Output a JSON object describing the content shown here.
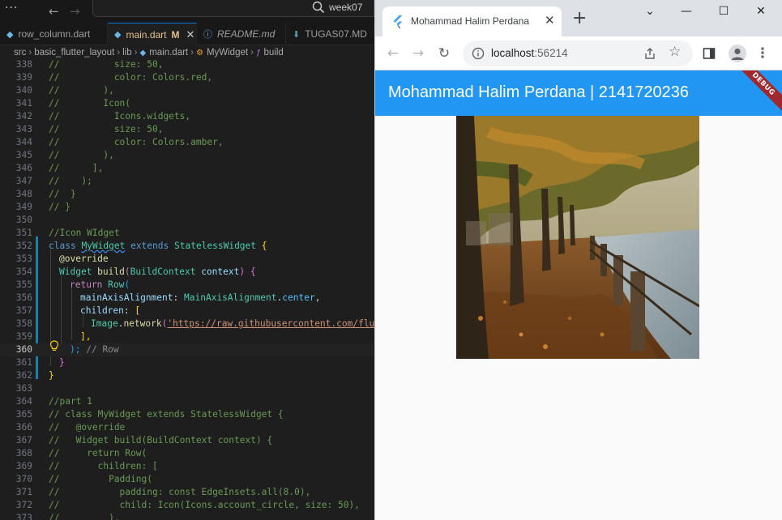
{
  "vscode": {
    "menu_dots": "···",
    "nav_back": "←",
    "nav_forward": "→",
    "search_text": "week07",
    "tabs": [
      {
        "label": "row_column.dart",
        "icon": "dart-file-icon"
      },
      {
        "label": "main.dart",
        "marker": "M",
        "icon": "dart-file-icon",
        "active": true
      },
      {
        "label": "README.md",
        "icon": "info-icon"
      },
      {
        "label": "TUGAS07.MD",
        "icon": "download-icon"
      }
    ],
    "close_glyph": "✕",
    "breadcrumb": [
      "src",
      "basic_flutter_layout",
      "lib",
      "main.dart",
      "MyWidget",
      "build"
    ],
    "lines": {
      "l338": {
        "n": "338",
        "t": "//          size: 50,"
      },
      "l339": {
        "n": "339",
        "t": "//          color: Colors.red,"
      },
      "l340": {
        "n": "340",
        "t": "//        ),"
      },
      "l341": {
        "n": "341",
        "t": "//        Icon("
      },
      "l342": {
        "n": "342",
        "t": "//          Icons.widgets,"
      },
      "l343": {
        "n": "343",
        "t": "//          size: 50,"
      },
      "l344": {
        "n": "344",
        "t": "//          color: Colors.amber,"
      },
      "l345": {
        "n": "345",
        "t": "//        ),"
      },
      "l346": {
        "n": "346",
        "t": "//      ],"
      },
      "l347": {
        "n": "347",
        "t": "//    );"
      },
      "l348": {
        "n": "348",
        "t": "//  }"
      },
      "l349": {
        "n": "349",
        "t": "// }"
      },
      "l350": {
        "n": "350",
        "t": ""
      },
      "l351": {
        "n": "351",
        "t": "//Icon WIdget"
      },
      "l352": {
        "n": "352",
        "kw_class": "class",
        "cls": "MyWidget",
        "kw_extends": "extends",
        "sup": "StatelessWidget",
        "brace": "{"
      },
      "l353": {
        "n": "353",
        "t": "@override"
      },
      "l354": {
        "n": "354",
        "ty": "Widget",
        "fn": "build",
        "p1": "(",
        "ptype": "BuildContext",
        "pname": "context",
        "p2": ")",
        "brace": "{"
      },
      "l355": {
        "n": "355",
        "kw": "return",
        "ty": "Row",
        "p": "("
      },
      "l356": {
        "n": "356",
        "prop": "mainAxisAlignment",
        "colon": ":",
        "ty": "MainAxisAlignment",
        "dot": ".",
        "val": "center",
        "comma": ","
      },
      "l357": {
        "n": "357",
        "prop": "children",
        "colon": ":",
        "br": "["
      },
      "l358": {
        "n": "358",
        "ty": "Image",
        "dot": ".",
        "fn": "network",
        "p": "(",
        "str": "'https://raw.githubusercontent.com/flutte"
      },
      "l359": {
        "n": "359",
        "br": "],"
      },
      "l360": {
        "n": "360",
        "close": ");",
        "cm": "// Row"
      },
      "l361": {
        "n": "361",
        "t": "}"
      },
      "l362": {
        "n": "362",
        "t": "}"
      },
      "l363": {
        "n": "363",
        "t": ""
      },
      "l364": {
        "n": "364",
        "t": "//part 1"
      },
      "l365": {
        "n": "365",
        "t": "// class MyWidget extends StatelessWidget {"
      },
      "l366": {
        "n": "366",
        "t": "//   @override"
      },
      "l367": {
        "n": "367",
        "t": "//   Widget build(BuildContext context) {"
      },
      "l368": {
        "n": "368",
        "t": "//     return Row("
      },
      "l369": {
        "n": "369",
        "t": "//       children: ["
      },
      "l370": {
        "n": "370",
        "t": "//         Padding("
      },
      "l371": {
        "n": "371",
        "t": "//           padding: const EdgeInsets.all(8.0),"
      },
      "l372": {
        "n": "372",
        "t": "//           child: Icon(Icons.account_circle, size: 50),"
      },
      "l373": {
        "n": "373",
        "t": "//         ),"
      }
    }
  },
  "browser": {
    "tab_title": "Mohammad Halim Perdana |",
    "tab_close": "✕",
    "new_tab": "+",
    "window_buttons": {
      "dropdown": "⌄",
      "minimize": "—",
      "maximize": "☐",
      "close": "✕"
    },
    "url_host": "localhost",
    "url_port": ":56214",
    "app_title": "Mohammad Halim Perdana | 2141720236",
    "debug_banner": "DEBUG",
    "colors": {
      "app_bar": "#2196f3",
      "debug_banner": "#a0282e",
      "page_bg": "#fafafa"
    }
  }
}
